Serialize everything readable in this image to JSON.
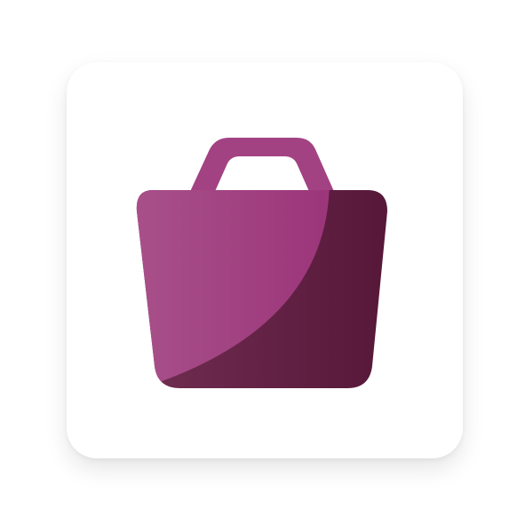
{
  "app_icon": {
    "icon": "shopping-bag-icon",
    "colors": {
      "tile_background": "#ffffff",
      "bag_light_start": "#a8508a",
      "bag_light_end": "#9b3479",
      "bag_dark_start": "#6e2c4f",
      "bag_dark_end": "#561739",
      "handle": "#a34283"
    }
  }
}
